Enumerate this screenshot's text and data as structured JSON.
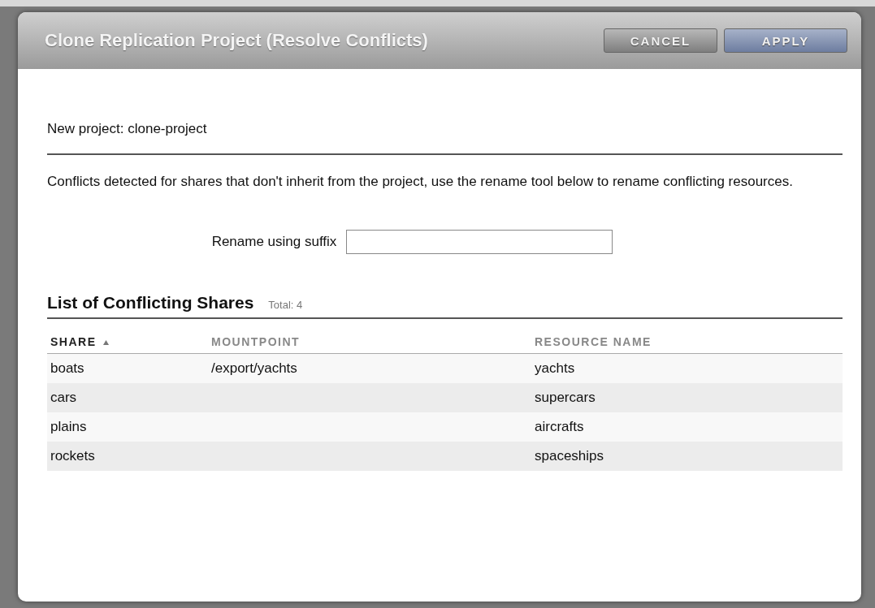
{
  "dialog": {
    "title": "Clone Replication Project (Resolve Conflicts)",
    "buttons": [
      {
        "label": "CANCEL",
        "kind": "secondary"
      },
      {
        "label": "APPLY",
        "kind": "primary"
      }
    ]
  },
  "new_project": "New project: clone-project",
  "message": "Conflicts detected for shares that don't inherit from the project, use the rename tool below to rename conflicting resources.",
  "rename": {
    "label": "Rename using suffix"
  },
  "list": {
    "title": "List of Conflicting Shares",
    "total": "Total: 4"
  },
  "table": {
    "columns": [
      {
        "label": "SHARE",
        "sorted": true
      },
      {
        "label": "MOUNTPOINT",
        "sorted": false
      },
      {
        "label": "RESOURCE NAME",
        "sorted": false
      }
    ],
    "rows": [
      [
        "boats",
        "/export/yachts",
        "yachts"
      ],
      [
        "cars",
        "",
        "supercars"
      ],
      [
        "plains",
        "",
        "aircrafts"
      ],
      [
        "rockets",
        "",
        "spaceships"
      ]
    ]
  }
}
